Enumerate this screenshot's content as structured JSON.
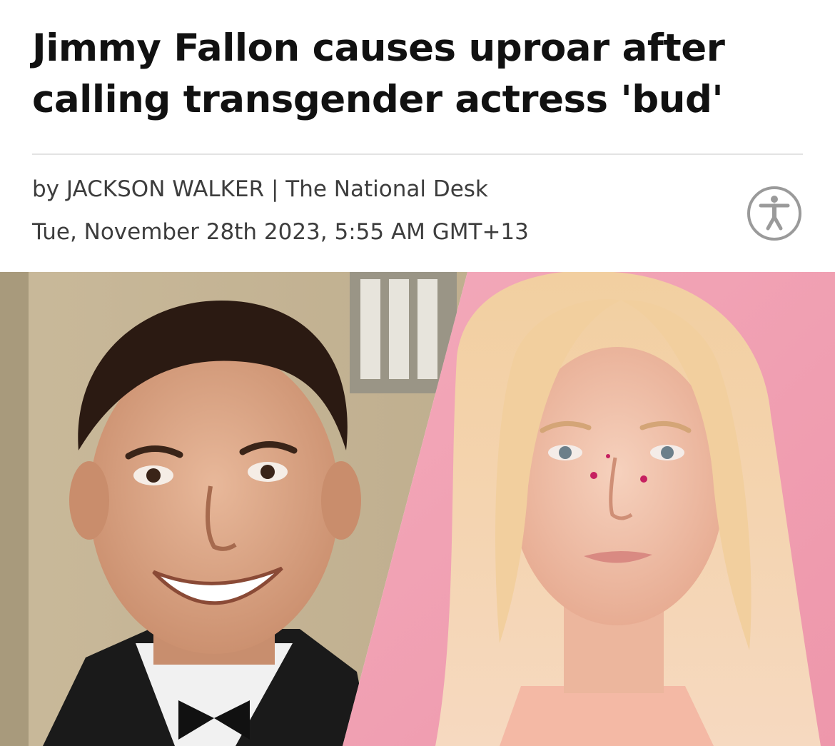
{
  "article": {
    "headline": "Jimmy Fallon causes uproar after calling transgender actress 'bud'",
    "byline_prefix": "by ",
    "author": "JACKSON WALKER",
    "separator": " | ",
    "publication": "The National Desk",
    "timestamp": "Tue, November 28th 2023, 5:55 AM GMT+13"
  },
  "icons": {
    "accessibility": "accessibility-icon"
  },
  "colors": {
    "headline": "#111111",
    "meta_text": "#3d3d3d",
    "icon_stroke": "#9a9a9a",
    "pink_background": "#f0a3b4"
  }
}
